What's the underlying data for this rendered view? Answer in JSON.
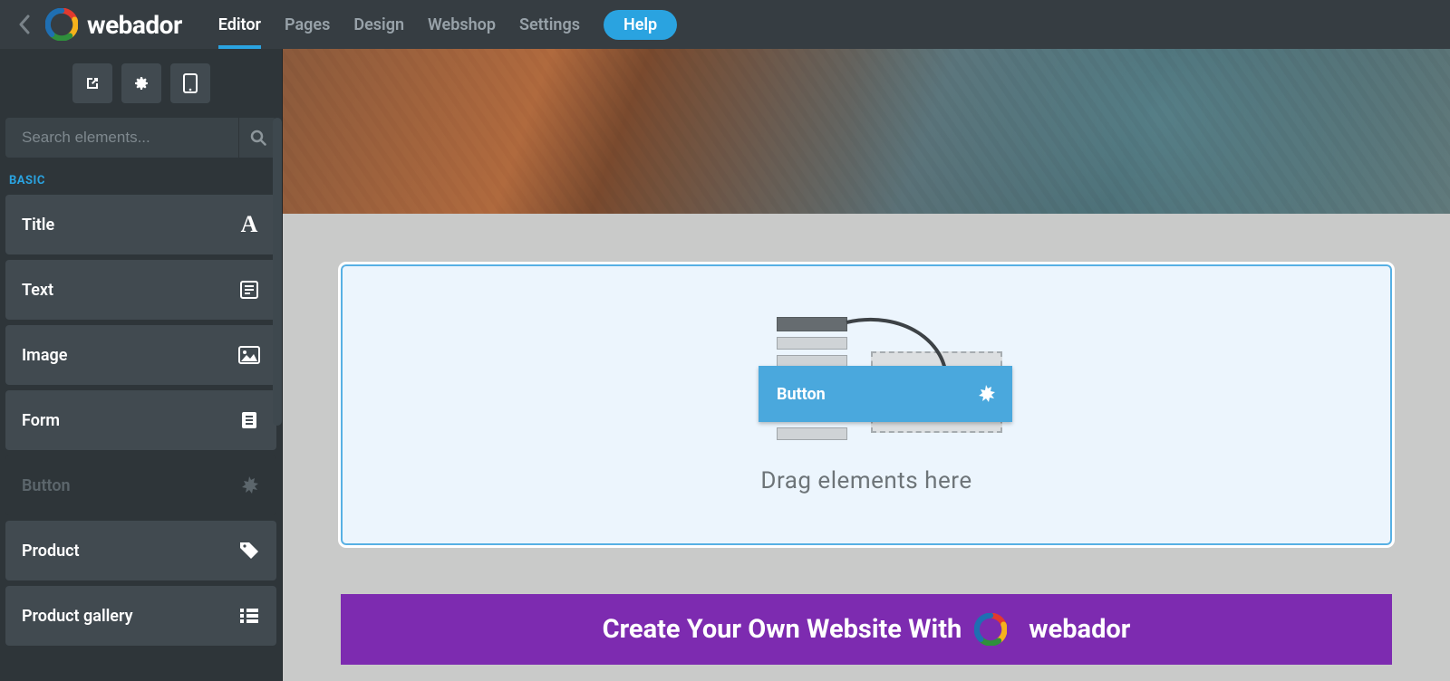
{
  "brand": "webador",
  "nav": {
    "tabs": [
      "Editor",
      "Pages",
      "Design",
      "Webshop",
      "Settings"
    ],
    "help": "Help",
    "active_index": 0
  },
  "sidebar": {
    "search_placeholder": "Search elements...",
    "section_label": "BASIC",
    "elements": [
      {
        "label": "Title",
        "icon": "title-icon"
      },
      {
        "label": "Text",
        "icon": "text-icon"
      },
      {
        "label": "Image",
        "icon": "image-icon"
      },
      {
        "label": "Form",
        "icon": "form-icon"
      },
      {
        "label": "Button",
        "icon": "burst-icon",
        "dragging": true
      },
      {
        "label": "Product",
        "icon": "tag-icon"
      },
      {
        "label": "Product gallery",
        "icon": "list-icon"
      }
    ]
  },
  "dropzone": {
    "chip_label": "Button",
    "hint": "Drag elements here"
  },
  "promo": {
    "text": "Create Your Own Website With",
    "brand": "webador"
  },
  "colors": {
    "accent": "#2aa3e0",
    "promo_bg": "#7d2bb0"
  }
}
